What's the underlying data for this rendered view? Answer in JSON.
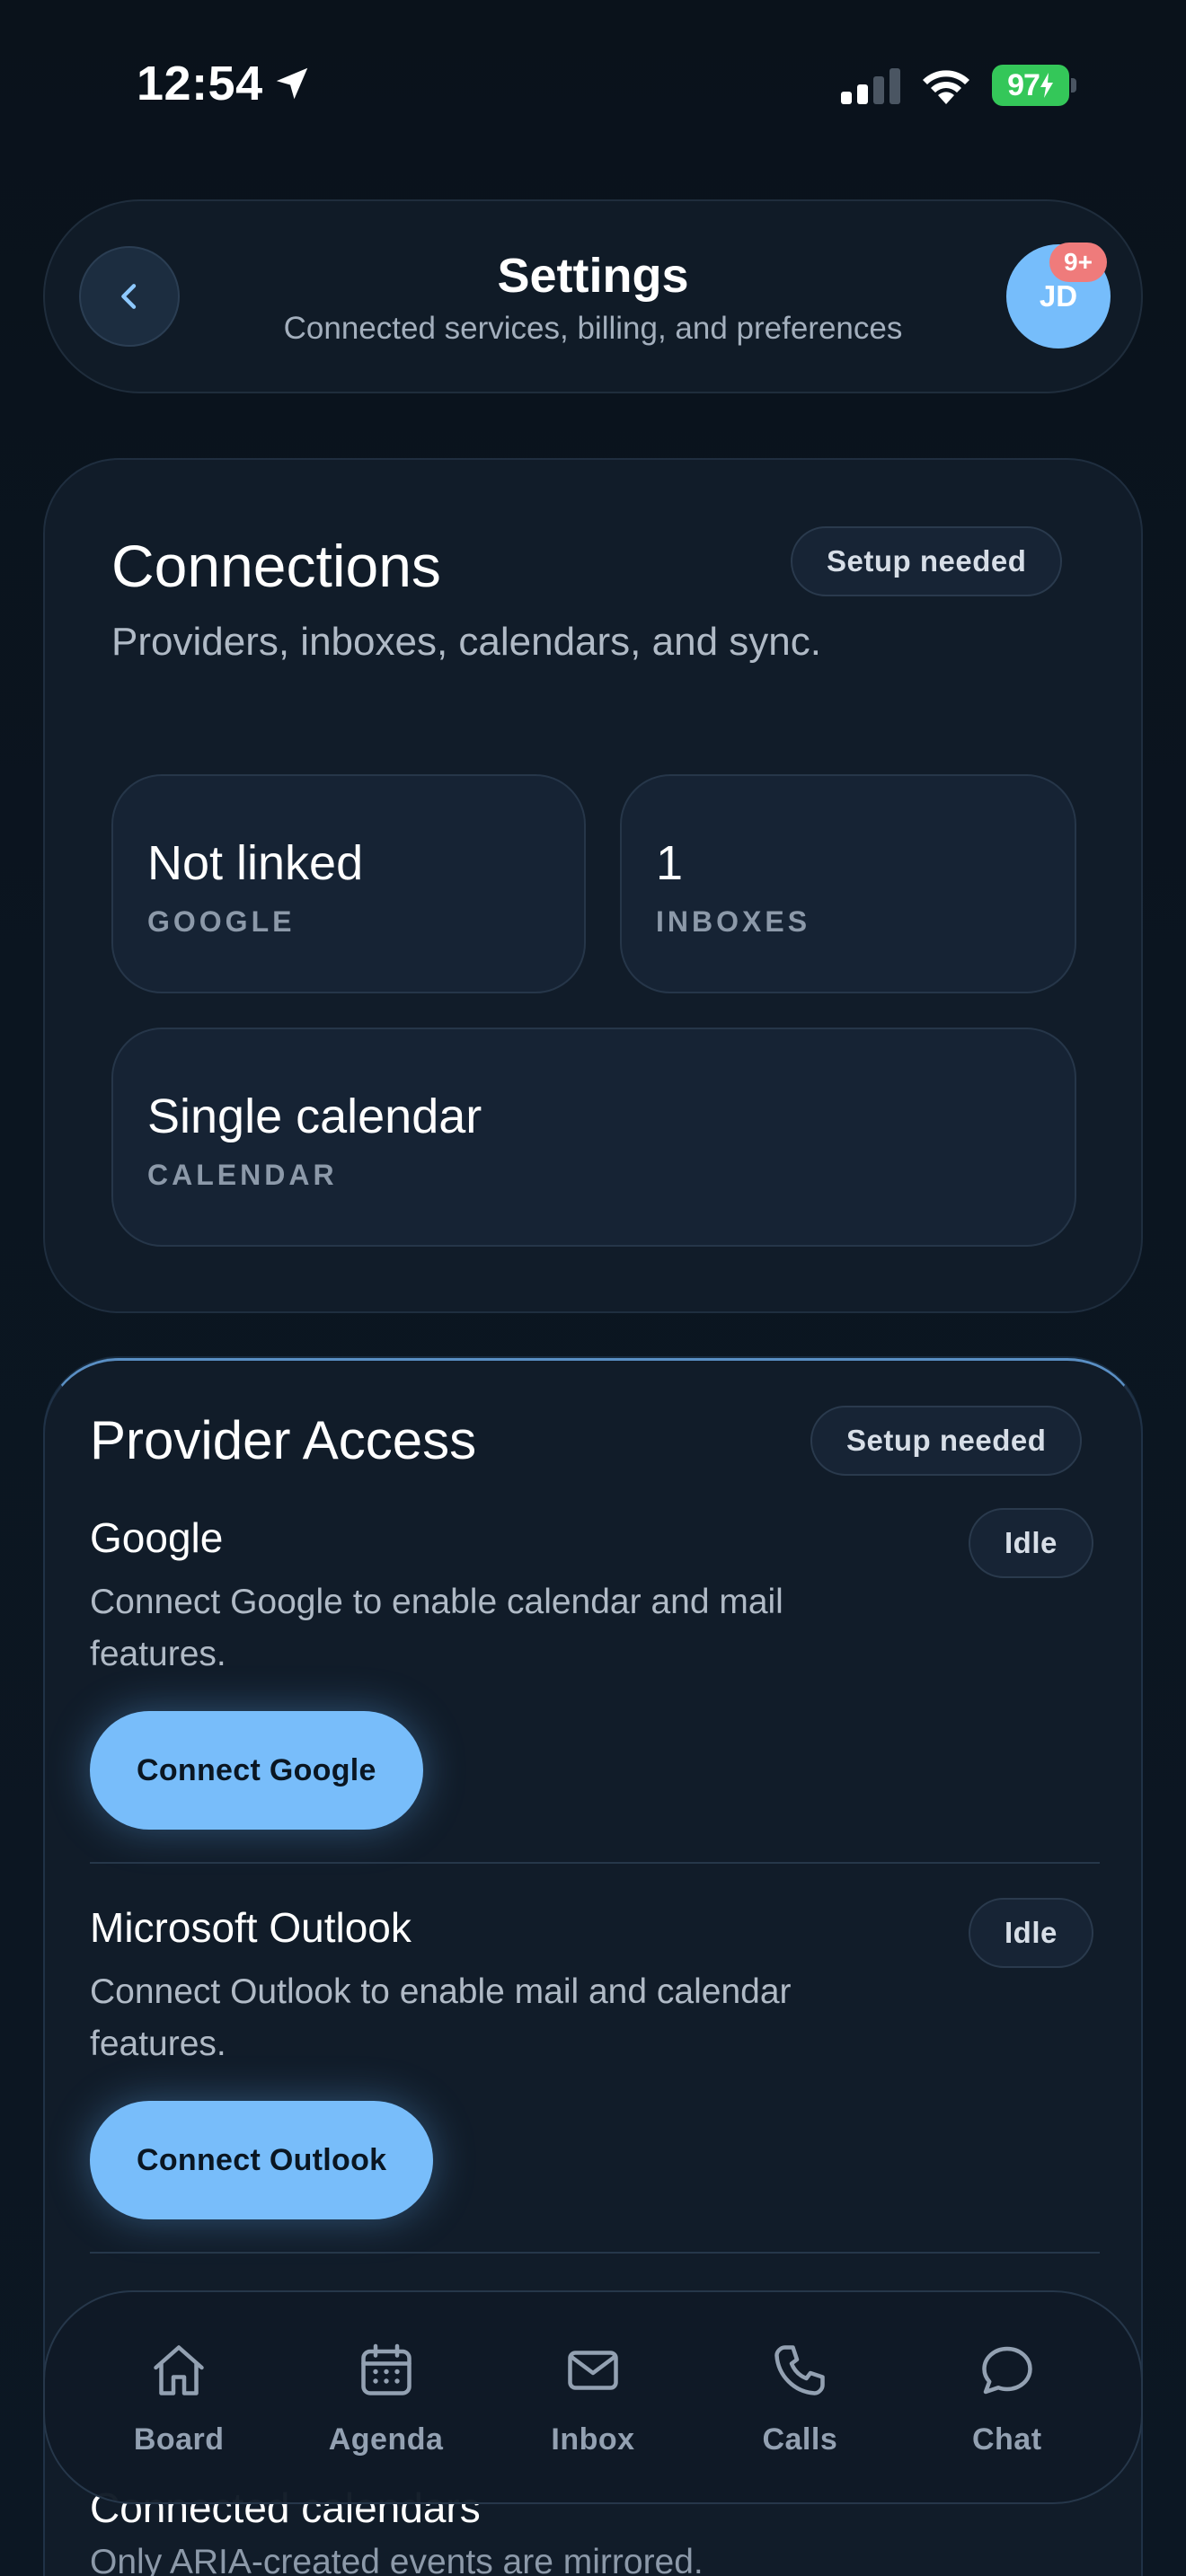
{
  "status_bar": {
    "time": "12:54",
    "battery": "97"
  },
  "header": {
    "title": "Settings",
    "subtitle": "Connected services, billing, and preferences",
    "avatar_initials": "JD",
    "notification_badge": "9+"
  },
  "connections": {
    "title": "Connections",
    "subtitle": "Providers, inboxes, calendars, and sync.",
    "status": "Setup needed",
    "stats": [
      {
        "value": "Not linked",
        "label": "GOOGLE"
      },
      {
        "value": "1",
        "label": "INBOXES"
      },
      {
        "value": "Single calendar",
        "label": "CALENDAR"
      }
    ]
  },
  "provider_access": {
    "title": "Provider Access",
    "status": "Setup needed",
    "providers": [
      {
        "name": "Google",
        "status": "Idle",
        "description": "Connect Google to enable calendar and mail features.",
        "button_label": "Connect Google"
      },
      {
        "name": "Microsoft Outlook",
        "status": "Idle",
        "description": "Connect Outlook to enable mail and calendar features.",
        "button_label": "Connect Outlook"
      }
    ],
    "calendars": {
      "title": "Connected calendars",
      "description": "Only ARIA-created events are mirrored."
    }
  },
  "nav": {
    "items": [
      {
        "label": "Board",
        "icon": "home-icon"
      },
      {
        "label": "Agenda",
        "icon": "calendar-icon"
      },
      {
        "label": "Inbox",
        "icon": "mail-icon"
      },
      {
        "label": "Calls",
        "icon": "phone-icon"
      },
      {
        "label": "Chat",
        "icon": "chat-bubble-icon"
      }
    ]
  },
  "colors": {
    "background": "#0a121b",
    "card": "#111c29",
    "accent": "#78bdfa",
    "badge": "#ef7b7b",
    "battery": "#34c759"
  }
}
